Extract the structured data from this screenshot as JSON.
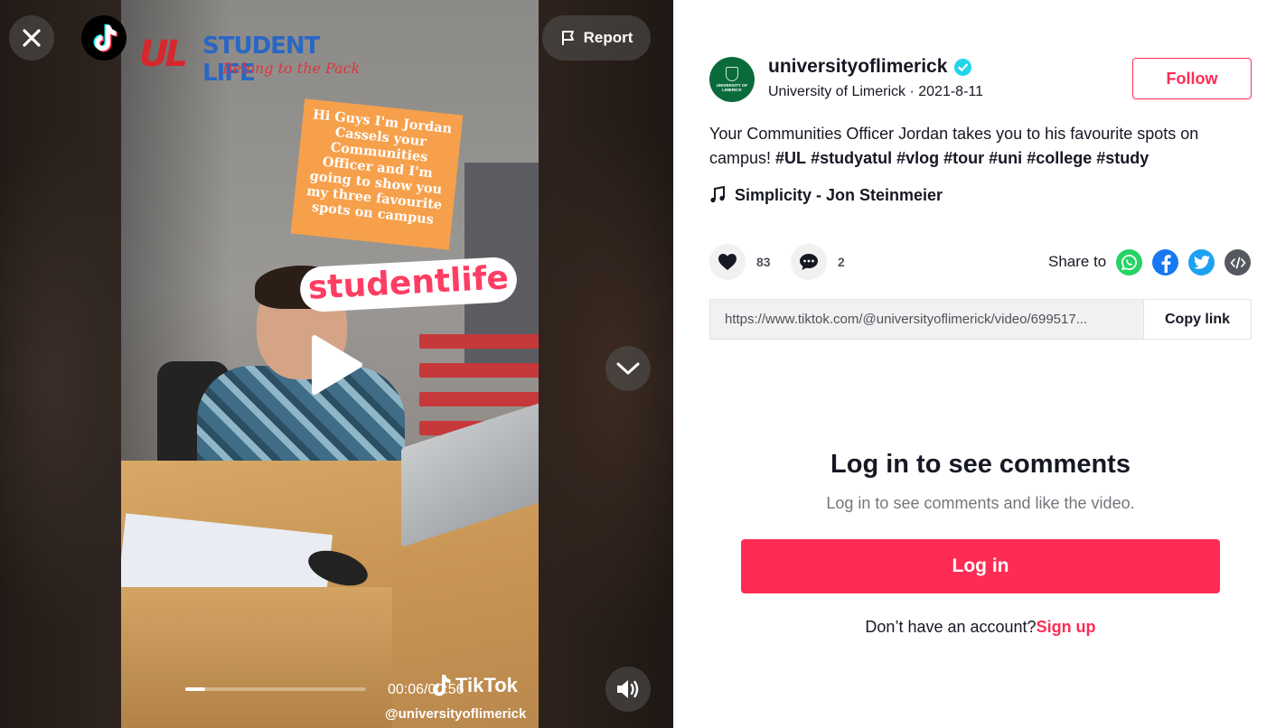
{
  "video": {
    "report_label": "Report",
    "time_current": "00:06",
    "time_separator": "/",
    "time_total": "00:56",
    "progress_fraction": 0.11,
    "watermark_brand": "TikTok",
    "watermark_handle": "@universityoflimerick",
    "overlay_sticker_text": "Hi Guys I'm Jordan Cassels your Communities Officer and I'm going to show you my three favourite spots on campus",
    "overlay_studentlife": "studentlife",
    "logo_mark": "UL",
    "logo_title": "STUDENT LIFE",
    "logo_tagline": "Belong to the Pack"
  },
  "author": {
    "username": "universityoflimerick",
    "display_name": "University of Limerick",
    "separator": " · ",
    "date": "2021-8-11",
    "follow_label": "Follow",
    "avatar_text": "UNIVERSITY OF LIMERICK"
  },
  "description": {
    "text": "Your Communities Officer Jordan takes you to his favourite spots on campus!",
    "hashtags": [
      "#UL",
      "#studyatul",
      "#vlog",
      "#tour",
      "#uni",
      "#college",
      "#study"
    ]
  },
  "music": {
    "title": "Simplicity - Jon Steinmeier"
  },
  "stats": {
    "likes": "83",
    "comments": "2"
  },
  "share": {
    "label": "Share to",
    "link_url": "https://www.tiktok.com/@universityoflimerick/video/699517...",
    "copy_label": "Copy link",
    "icons": [
      "whatsapp-icon",
      "facebook-icon",
      "twitter-icon",
      "embed-icon"
    ]
  },
  "login": {
    "title": "Log in to see comments",
    "subtitle": "Log in to see comments and like the video.",
    "button_label": "Log in",
    "no_account_text": "Don’t have an account?",
    "signup_label": "Sign up"
  },
  "colors": {
    "accent": "#fe2c55",
    "verified": "#20d5ec",
    "whatsapp": "#25d366",
    "facebook": "#1877f2",
    "twitter": "#1da1f2"
  }
}
